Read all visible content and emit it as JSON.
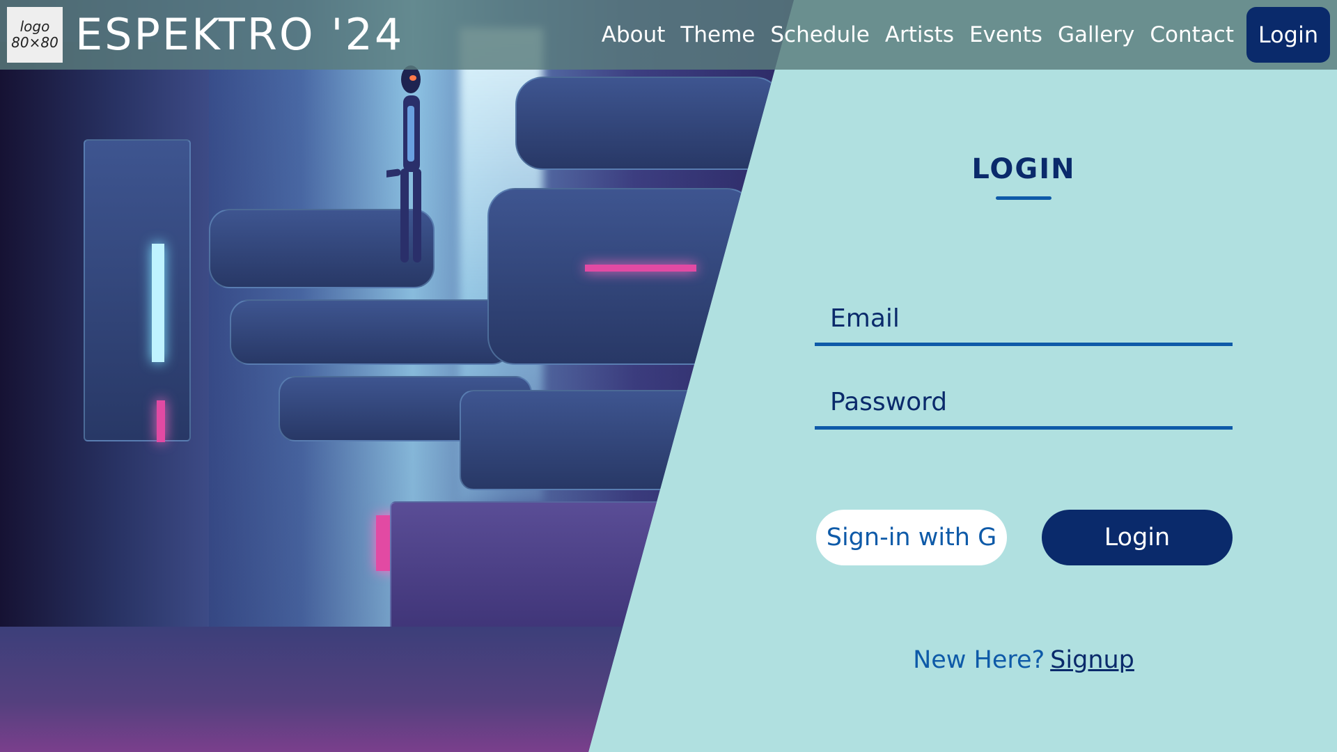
{
  "header": {
    "logo_placeholder_line1": "logo",
    "logo_placeholder_line2": "80×80",
    "brand": "ESPEKTRO '24",
    "nav": [
      {
        "label": "About"
      },
      {
        "label": "Theme"
      },
      {
        "label": "Schedule"
      },
      {
        "label": "Artists"
      },
      {
        "label": "Events"
      },
      {
        "label": "Gallery"
      },
      {
        "label": "Contact"
      }
    ],
    "login_label": "Login"
  },
  "login_form": {
    "title": "LOGIN",
    "email_placeholder": "Email",
    "password_placeholder": "Password",
    "google_button_label": "Sign-in with G",
    "login_button_label": "Login",
    "new_here_text": "New Here?",
    "signup_link_label": "Signup"
  },
  "colors": {
    "background": "#b0e0e0",
    "navbar": "#5a7d7d",
    "primary_dark": "#0a2a6b",
    "accent_blue": "#0e5aa8",
    "white": "#ffffff"
  },
  "hero_image": {
    "description_icon": "cyberpunk-city-illustration"
  }
}
